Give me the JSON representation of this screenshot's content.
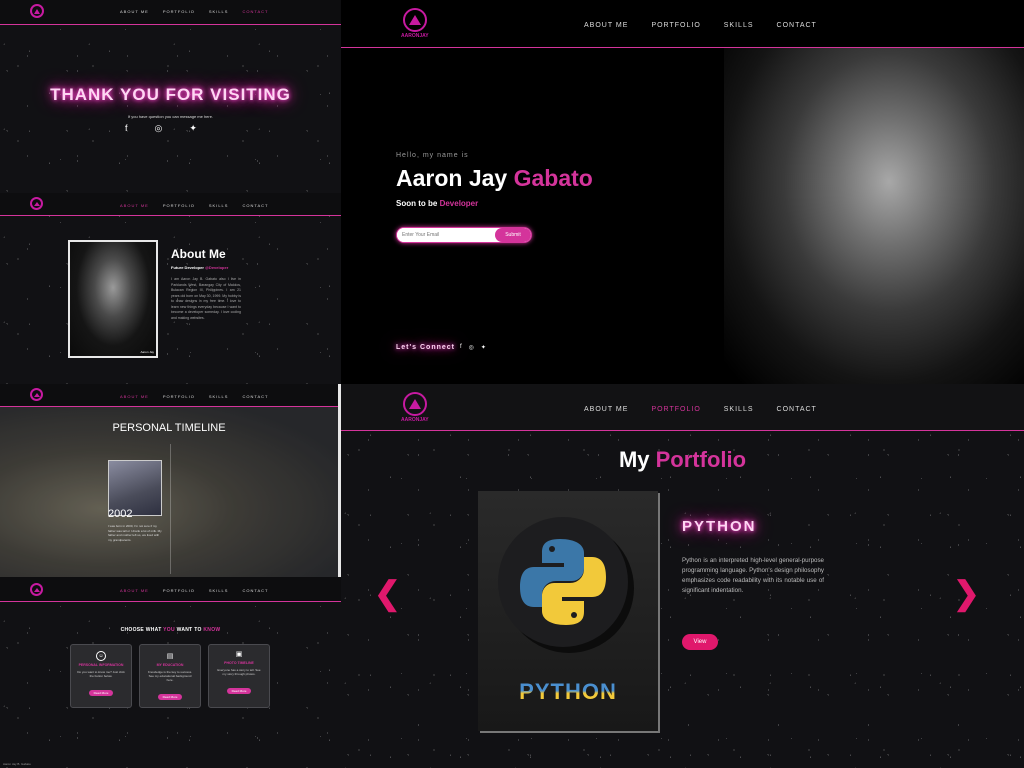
{
  "nav": {
    "brand": "AARONJAY",
    "about": "ABOUT ME",
    "portfolio": "PORTFOLIO",
    "skills": "SKILLS",
    "contact": "CONTACT"
  },
  "thanks": {
    "title": "THANK YOU FOR VISITING",
    "subtitle": "If you have question you can message me here."
  },
  "about_small": {
    "title": "About Me",
    "role": "Future Developer",
    "handle": "@Developer",
    "photo_caption": "Aaron Jay",
    "bio": "I am Aaron Jay B. Gabato also I live in Parklands West, Barangay City of Malolos, Bulacan Region III, Philippines. I am 21 years old born on May 30, 1999. My hobby is to draw designs in my free time. I love to learn new things everyday because I want to become a developer someday. I love coding and making websites."
  },
  "timeline": {
    "title": "PERSONAL TIMELINE",
    "year": "2002",
    "caption": "I was born in 2000, I'm not sure if my father was tall or I drank a lot of milk. My father and mother left us, we lived with my grandparents."
  },
  "choose": {
    "pre": "CHOOSE WHAT ",
    "you": "YOU",
    "mid": " WANT TO ",
    "know": "KNOW",
    "cards": [
      {
        "title": "PERSONAL INFORMATION",
        "text": "Do you want to know me? Just click the button below.",
        "button": "Read More"
      },
      {
        "title": "MY EDUCATION",
        "text": "Knowledge is the key to success. See my educational background here.",
        "button": "Read More"
      },
      {
        "title": "PHOTO TIMELINE",
        "text": "Everyone has a story to tell. See my story through photos.",
        "button": "Read More"
      }
    ]
  },
  "footer_text": "Aaron Jay B. Gabato",
  "hero": {
    "greeting": "Hello, my name is",
    "first_name": "Aaron Jay ",
    "last_name": "Gabato",
    "tagline_pre": "Soon to be ",
    "tagline_role": "Developer",
    "email_placeholder": "Enter Your Email",
    "submit": "Submit",
    "connect": "Let's Connect"
  },
  "portfolio": {
    "title_pre": "My ",
    "title_accent": "Portfolio",
    "item_title": "PYTHON",
    "item_logo_text": "PYTHON",
    "item_desc": "Python is an interpreted high-level general-purpose programming language. Python's design philosophy emphasizes code readability with its notable use of significant indentation.",
    "view": "View"
  },
  "colors": {
    "accent": "#d4349b",
    "button": "#e0186c",
    "background": "#0b0b0d"
  }
}
